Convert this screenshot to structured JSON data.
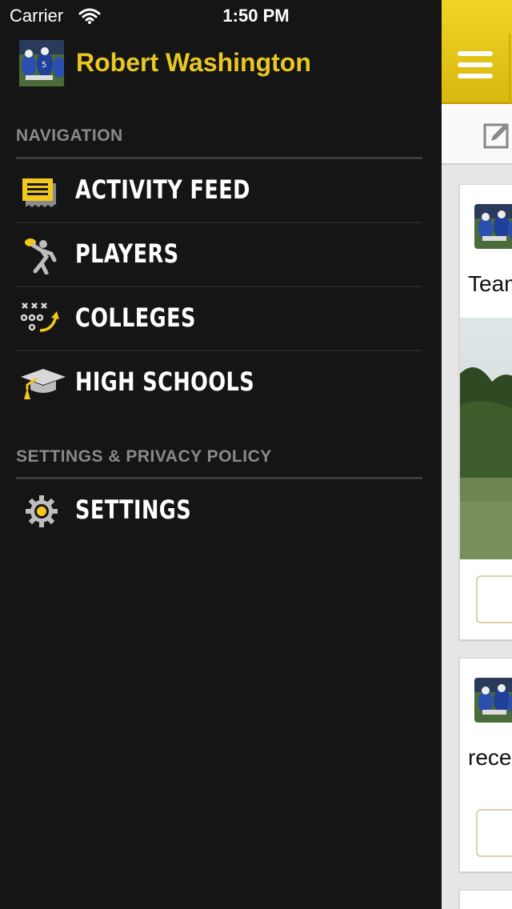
{
  "status_bar": {
    "carrier": "Carrier",
    "time": "1:50 PM"
  },
  "profile": {
    "name": "Robert Washington"
  },
  "sections": {
    "navigation_title": "NAVIGATION",
    "settings_title": "SETTINGS & PRIVACY POLICY"
  },
  "nav_items": [
    {
      "label": "ACTIVITY FEED",
      "icon": "activity-feed-icon"
    },
    {
      "label": "PLAYERS",
      "icon": "player-icon"
    },
    {
      "label": "COLLEGES",
      "icon": "playbook-icon"
    },
    {
      "label": "HIGH SCHOOLS",
      "icon": "graduation-cap-icon"
    }
  ],
  "settings_items": [
    {
      "label": "SETTINGS",
      "icon": "gear-icon"
    }
  ],
  "feed": {
    "posts": [
      {
        "snippet": "Team"
      },
      {
        "snippet": "recei"
      }
    ]
  },
  "colors": {
    "accent": "#e9c822",
    "sidebar_bg": "#151515",
    "topbar": "#d8b70e"
  }
}
